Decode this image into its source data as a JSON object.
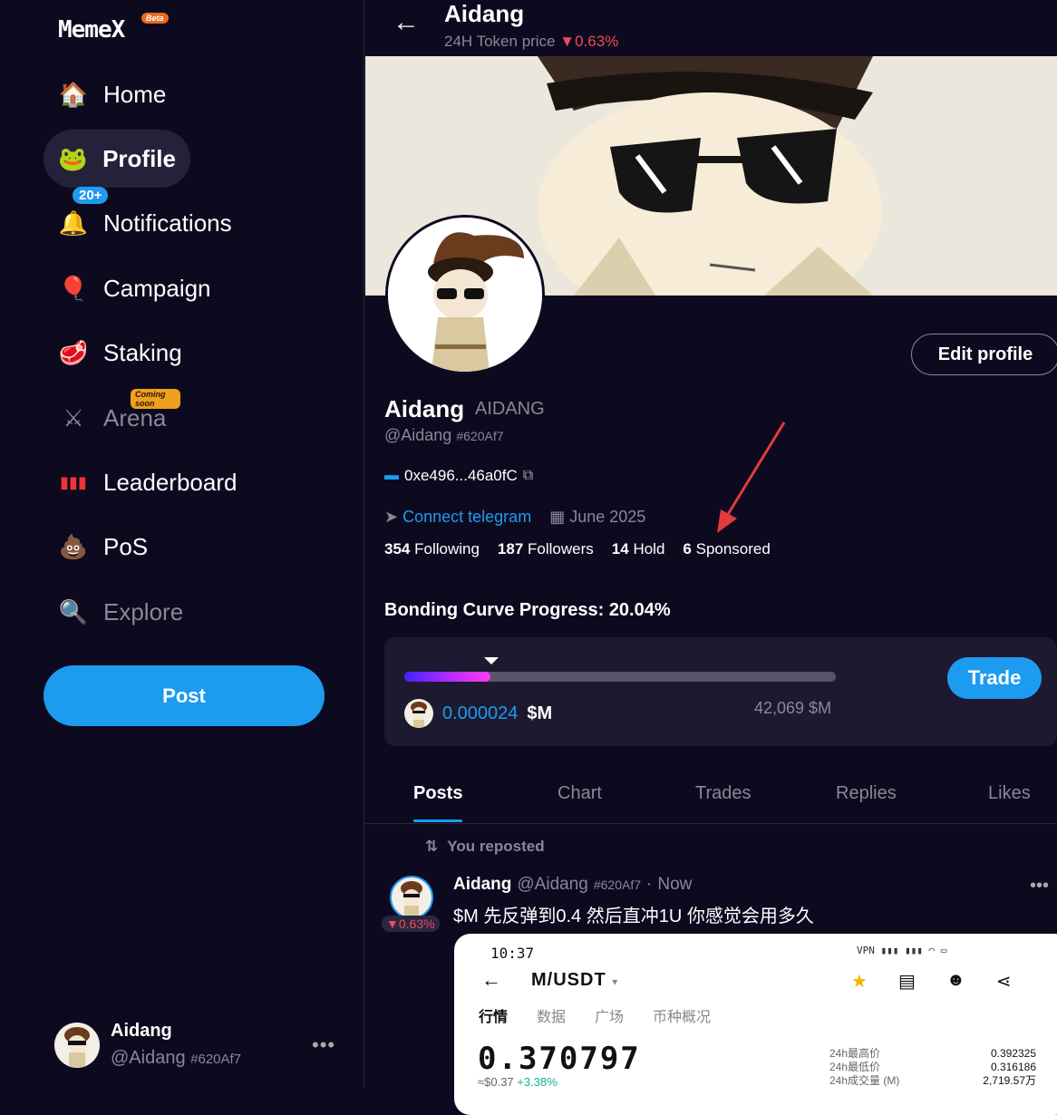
{
  "sidebar": {
    "logo": "MemeX",
    "logo_badge": "Beta",
    "items": [
      {
        "label": "Home"
      },
      {
        "label": "Profile"
      },
      {
        "label": "Notifications",
        "badge": "20+"
      },
      {
        "label": "Campaign"
      },
      {
        "label": "Staking"
      },
      {
        "label": "Arena",
        "tag": "Coming soon"
      },
      {
        "label": "Leaderboard"
      },
      {
        "label": "PoS"
      },
      {
        "label": "Explore"
      }
    ],
    "post_label": "Post",
    "account": {
      "name": "Aidang",
      "handle": "@Aidang",
      "tag": "#620Af7",
      "more": "•••"
    }
  },
  "header": {
    "title": "Aidang",
    "subtitle": "24H Token price",
    "change": "▼0.63%"
  },
  "profile": {
    "edit_label": "Edit profile",
    "name": "Aidang",
    "symbol": "AIDANG",
    "handle": "@Aidang",
    "tag": "#620Af7",
    "wallet": "0xe496...46a0fC",
    "telegram": "Connect telegram",
    "joined": "June 2025",
    "stats": [
      {
        "num": "354",
        "label": "Following"
      },
      {
        "num": "187",
        "label": "Followers"
      },
      {
        "num": "14",
        "label": "Hold"
      },
      {
        "num": "6",
        "label": "Sponsored"
      }
    ]
  },
  "bonding": {
    "title": "Bonding Curve Progress: 20.04%",
    "progress": 0.2004,
    "current_value": "0.000024",
    "unit": "$M",
    "target": "42,069 $M",
    "trade_label": "Trade"
  },
  "tabs": [
    "Posts",
    "Chart",
    "Trades",
    "Replies",
    "Likes"
  ],
  "post": {
    "repost_label": "You reposted",
    "author": "Aidang",
    "handle": "@Aidang",
    "tag": "#620Af7",
    "time": "Now",
    "change": "▼0.63%",
    "text": "$M 先反弹到0.4 然后直冲1U 你感觉会用多久",
    "more": "•••",
    "image": {
      "time": "10:37",
      "pair": "M/USDT",
      "tabs": [
        "行情",
        "数据",
        "广场",
        "币种概况"
      ],
      "price": "0.370797",
      "sub_price": "≈$0.37",
      "sub_change": "+3.38%",
      "stat_labels": [
        "24h最高价",
        "24h最低价",
        "24h成交量 (M)"
      ],
      "stat_values": [
        "0.392325",
        "0.316186",
        "2,719.57万"
      ]
    }
  },
  "colors": {
    "accent": "#1d9bf0",
    "down": "#f04a5a",
    "bg": "#0d0a1f"
  }
}
